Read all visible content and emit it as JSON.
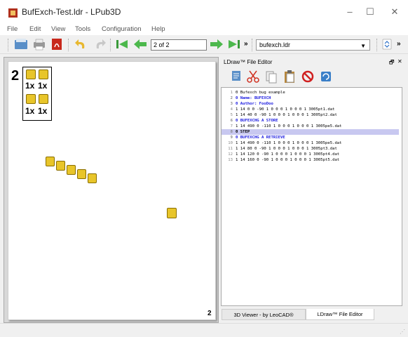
{
  "window": {
    "title": "BufExch-Test.ldr - LPub3D",
    "minimize": "–",
    "maximize": "☐",
    "close": "✕"
  },
  "menu": [
    "File",
    "Edit",
    "View",
    "Tools",
    "Configuration",
    "Help"
  ],
  "toolbar": {
    "step_field": "2 of 2",
    "more_1": "»",
    "file_select": "bufexch.ldr",
    "more_2": "»",
    "icons": [
      "open-file-icon",
      "print-icon",
      "pdf-export-icon",
      "undo-icon",
      "redo-icon",
      "first-page-icon",
      "previous-page-icon",
      "next-page-icon",
      "last-page-icon",
      "zoom-icon"
    ]
  },
  "page": {
    "step_number": "2",
    "page_number": "2",
    "pli_items": [
      {
        "qty": "1x"
      },
      {
        "qty": "1x"
      },
      {
        "qty": "1x"
      },
      {
        "qty": "1x"
      }
    ]
  },
  "editor": {
    "title": "LDraw™ File Editor",
    "float_icon": "🗗",
    "close_icon": "✕",
    "buttons": [
      "toggle-comment-icon",
      "cut-icon",
      "copy-icon",
      "paste-icon",
      "cancel-icon",
      "refresh-icon"
    ],
    "lines": [
      {
        "n": "1",
        "text": "0 Bufexch bug example",
        "meta": false
      },
      {
        "n": "2",
        "text": "0 Name: BUFEXCH",
        "meta": true
      },
      {
        "n": "3",
        "text": "0 Author: FooDoo",
        "meta": true
      },
      {
        "n": "4",
        "text": "1 14 0 0 -90 1 0 0 0 1 0 0 0 1 3005pt1.dat",
        "meta": false
      },
      {
        "n": "5",
        "text": "1 14 40 0 -90 1 0 0 0 1 0 0 0 1 3005pt2.dat",
        "meta": false
      },
      {
        "n": "6",
        "text": "0 BUFEXCHG A STORE",
        "meta": true
      },
      {
        "n": "7",
        "text": "1 14 490 0 -110 1 0 0 0 1 0 0 0 1 3005pe5.dat",
        "meta": false
      },
      {
        "n": "8",
        "text": "0 STEP",
        "meta": true,
        "highlight": true
      },
      {
        "n": "9",
        "text": "0 BUFEXCHG A RETRIEVE",
        "meta": true
      },
      {
        "n": "10",
        "text": "1 14 490 0 -110 1 0 0 0 1 0 0 0 1 3005pe5.dat",
        "meta": false
      },
      {
        "n": "11",
        "text": "1 14 80 0 -90 1 0 0 0 1 0 0 0 1 3005pt3.dat",
        "meta": false
      },
      {
        "n": "12",
        "text": "1 14 120 0 -90 1 0 0 0 1 0 0 0 1 3005pt4.dat",
        "meta": false
      },
      {
        "n": "13",
        "text": "1 14 160 0 -90 1 0 0 0 1 0 0 0 1 3005pt5.dat",
        "meta": false
      }
    ]
  },
  "tabs": [
    "3D Viewer - by LeoCAD®",
    "LDraw™ File Editor"
  ],
  "colors": {
    "accent": "#1a1ae0",
    "brick_yellow": "#e8c52a",
    "highlight": "#c8c8f0"
  }
}
